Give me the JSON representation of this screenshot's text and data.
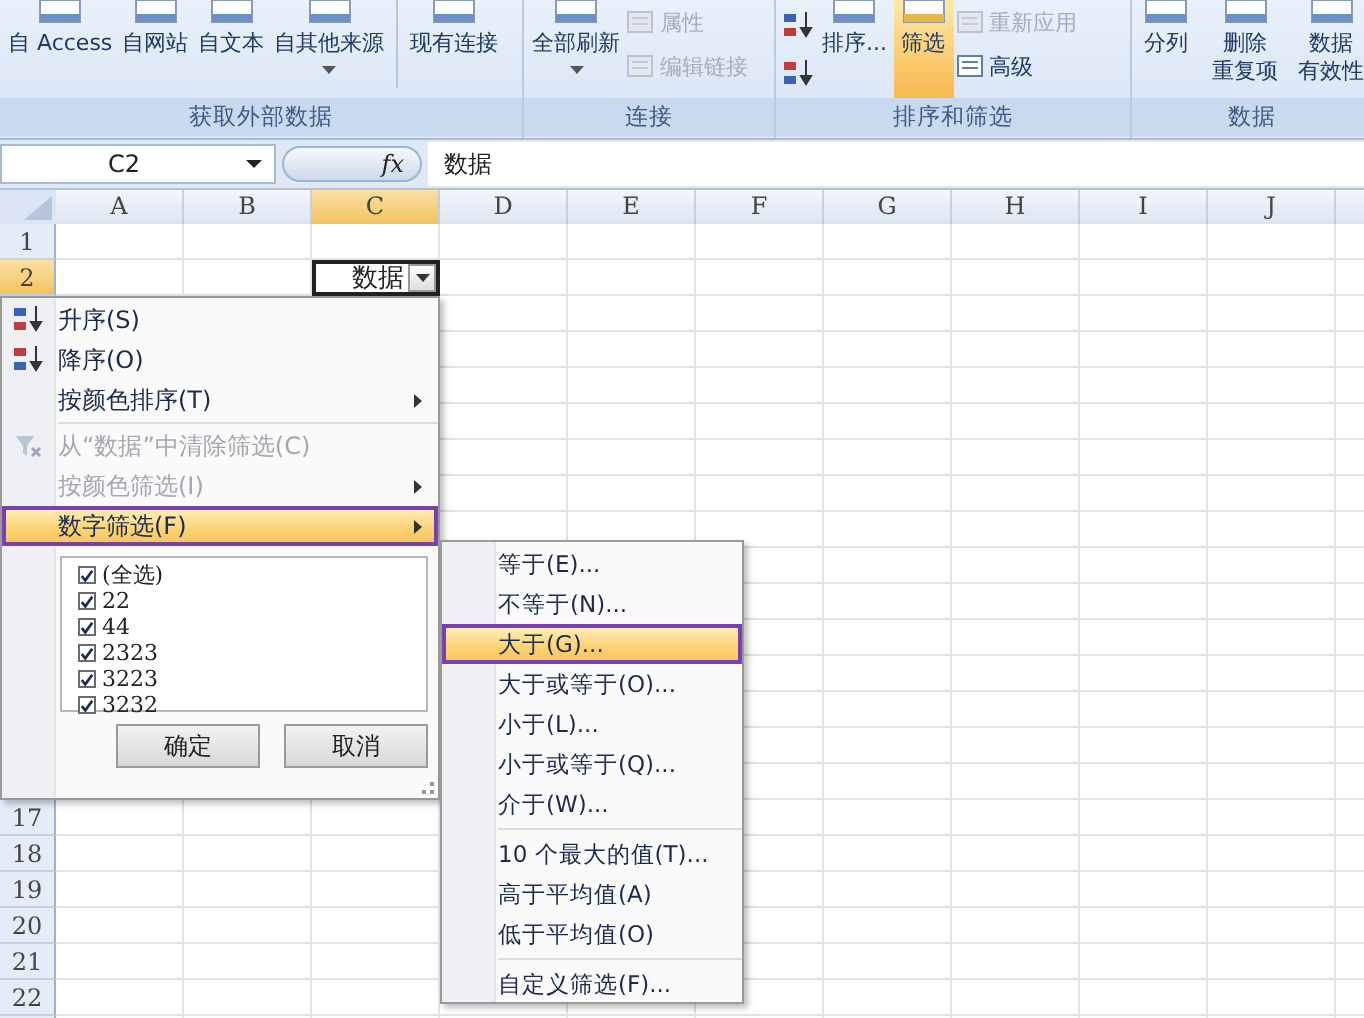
{
  "ribbon": {
    "groups": [
      {
        "label": "获取外部数据",
        "items": [
          {
            "kind": "large",
            "label": "自 Access",
            "caret": false,
            "selected": false
          },
          {
            "kind": "large",
            "label": "自网站",
            "caret": false,
            "selected": false
          },
          {
            "kind": "large",
            "label": "自文本",
            "caret": false,
            "selected": false
          },
          {
            "kind": "large",
            "label": "自其他来源",
            "caret": true,
            "selected": false
          },
          {
            "kind": "divider"
          },
          {
            "kind": "large",
            "label": "现有连接",
            "caret": false,
            "selected": false
          }
        ]
      },
      {
        "label": "连接",
        "items": [
          {
            "kind": "large",
            "label": "全部刷新",
            "caret": true,
            "selected": false
          },
          {
            "kind": "stack",
            "buttons": [
              {
                "label": "属性",
                "disabled": true
              },
              {
                "label": "编辑链接",
                "disabled": true
              }
            ]
          }
        ]
      },
      {
        "label": "排序和筛选",
        "items": [
          {
            "kind": "sorticons"
          },
          {
            "kind": "large",
            "label": "排序...",
            "caret": false,
            "selected": false
          },
          {
            "kind": "large",
            "label": "筛选",
            "caret": false,
            "selected": true
          },
          {
            "kind": "stack",
            "buttons": [
              {
                "label": "重新应用",
                "disabled": true
              },
              {
                "label": "高级",
                "disabled": false
              }
            ]
          }
        ]
      },
      {
        "label": "数据",
        "items": [
          {
            "kind": "large",
            "label": "分列",
            "caret": false,
            "selected": false
          },
          {
            "kind": "large",
            "label": [
              "删除",
              "重复项"
            ],
            "caret": false,
            "selected": false
          },
          {
            "kind": "large",
            "label": [
              "数据",
              "有效性"
            ],
            "caret": false,
            "selected": false
          }
        ]
      }
    ]
  },
  "formula_bar": {
    "name_box": "C2",
    "function_label": "fx",
    "value": "数据"
  },
  "sheet": {
    "columns": [
      {
        "label": "A",
        "selected": false
      },
      {
        "label": "B",
        "selected": false
      },
      {
        "label": "C",
        "selected": true
      },
      {
        "label": "D",
        "selected": false
      },
      {
        "label": "E",
        "selected": false
      },
      {
        "label": "F",
        "selected": false
      },
      {
        "label": "G",
        "selected": false
      },
      {
        "label": "H",
        "selected": false
      },
      {
        "label": "I",
        "selected": false
      },
      {
        "label": "J",
        "selected": false
      }
    ],
    "rows": [
      {
        "number": "1",
        "selected": false
      },
      {
        "number": "2",
        "selected": true,
        "cells": [
          null,
          null,
          {
            "value": "数据",
            "filter": true,
            "active": true
          }
        ]
      },
      {
        "number": "17",
        "selected": false
      },
      {
        "number": "18",
        "selected": false
      },
      {
        "number": "19",
        "selected": false
      },
      {
        "number": "20",
        "selected": false
      },
      {
        "number": "21",
        "selected": false
      },
      {
        "number": "22",
        "selected": false
      }
    ]
  },
  "filter_menu": {
    "items": [
      {
        "kind": "ascending",
        "label": "升序(S)",
        "disabled": false,
        "submenu": false,
        "selected": false,
        "outlined": false
      },
      {
        "kind": "descending",
        "label": "降序(O)",
        "disabled": false,
        "submenu": false,
        "selected": false,
        "outlined": false
      },
      {
        "kind": "plain",
        "label": "按颜色排序(T)",
        "disabled": false,
        "submenu": true,
        "selected": false,
        "outlined": false
      },
      {
        "kind": "separator"
      },
      {
        "kind": "clear",
        "label": "从“数据”中清除筛选(C)",
        "disabled": true,
        "submenu": false,
        "selected": false,
        "outlined": false
      },
      {
        "kind": "plain",
        "label": "按颜色筛选(I)",
        "disabled": true,
        "submenu": true,
        "selected": false,
        "outlined": false
      },
      {
        "kind": "plain",
        "label": "数字筛选(F)",
        "disabled": false,
        "submenu": true,
        "selected": true,
        "outlined": true
      }
    ],
    "values": [
      {
        "label": "(全选)",
        "checked": true
      },
      {
        "label": "22",
        "checked": true
      },
      {
        "label": "44",
        "checked": true
      },
      {
        "label": "2323",
        "checked": true
      },
      {
        "label": "3223",
        "checked": true
      },
      {
        "label": "3232",
        "checked": true
      }
    ],
    "buttons": [
      "确定",
      "取消"
    ]
  },
  "number_filter_menu": {
    "items": [
      {
        "kind": "plain",
        "label": "等于(E)...",
        "selected": false,
        "outlined": false
      },
      {
        "kind": "plain",
        "label": "不等于(N)...",
        "selected": false,
        "outlined": false
      },
      {
        "kind": "plain",
        "label": "大于(G)...",
        "selected": true,
        "outlined": true
      },
      {
        "kind": "plain",
        "label": "大于或等于(O)...",
        "selected": false,
        "outlined": false
      },
      {
        "kind": "plain",
        "label": "小于(L)...",
        "selected": false,
        "outlined": false
      },
      {
        "kind": "plain",
        "label": "小于或等于(Q)...",
        "selected": false,
        "outlined": false
      },
      {
        "kind": "plain",
        "label": "介于(W)...",
        "selected": false,
        "outlined": false
      },
      {
        "kind": "separator"
      },
      {
        "kind": "plain",
        "label": "10 个最大的值(T)...",
        "selected": false,
        "outlined": false
      },
      {
        "kind": "plain",
        "label": "高于平均值(A)",
        "selected": false,
        "outlined": false
      },
      {
        "kind": "plain",
        "label": "低于平均值(O)",
        "selected": false,
        "outlined": false
      },
      {
        "kind": "separator"
      },
      {
        "kind": "plain",
        "label": "自定义筛选(F)...",
        "selected": false,
        "outlined": false
      }
    ]
  }
}
